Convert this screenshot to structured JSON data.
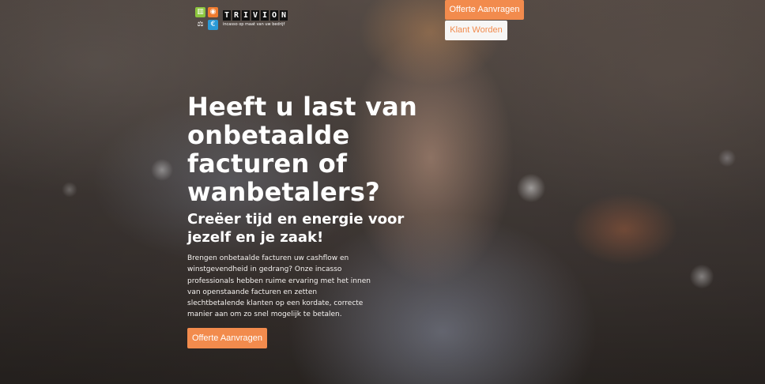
{
  "brand": {
    "name_letters": [
      "T",
      "R",
      "I",
      "V",
      "I",
      "O",
      "N"
    ],
    "tagline": "incasso op maat van uw bedrijf",
    "tiles": [
      {
        "glyph": "▥",
        "icon": "document-icon",
        "color": "#8cc63e"
      },
      {
        "glyph": "◉",
        "icon": "piggy-bank-icon",
        "color": "#f07b2e"
      },
      {
        "glyph": "⚖",
        "icon": "gavel-icon",
        "color": "transparent"
      },
      {
        "glyph": "€",
        "icon": "euro-icon",
        "color": "#2a9ad6"
      }
    ]
  },
  "nav": {
    "quote_label": "Offerte Aanvragen",
    "client_label": "Klant Worden"
  },
  "hero": {
    "title": "Heeft u last van onbetaalde facturen of wanbetalers?",
    "subtitle": "Creëer tijd en energie voor jezelf en je zaak!",
    "body": "Brengen onbetaalde facturen uw cashflow en winstgevendheid in gedrang? Onze incasso professionals hebben ruime ervaring met het innen van openstaande facturen en zetten slechtbetalende klanten op een kordate, correcte manier aan om zo snel mogelijk te betalen.",
    "cta_label": "Offerte Aanvragen"
  },
  "colors": {
    "accent": "#f28b4d",
    "button_light": "#f7f6f5"
  }
}
